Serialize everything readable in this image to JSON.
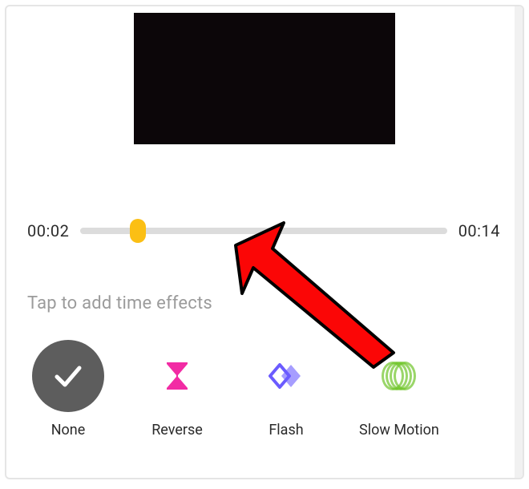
{
  "timeline": {
    "current_time": "00:02",
    "total_time": "00:14"
  },
  "hint": "Tap to add time effects",
  "effects": {
    "none_label": "None",
    "reverse_label": "Reverse",
    "flash_label": "Flash",
    "slow_motion_label": "Slow Motion"
  },
  "icons": {
    "checkmark": "checkmark-icon",
    "hourglass": "hourglass-icon",
    "diamonds": "diamonds-icon",
    "slow": "slow-motion-icon"
  },
  "colors": {
    "accent_yellow": "#fbbf14",
    "pink": "#f22ba4",
    "purple": "#6b5bff",
    "green": "#6fc52a",
    "arrow_red": "#fb0606"
  }
}
